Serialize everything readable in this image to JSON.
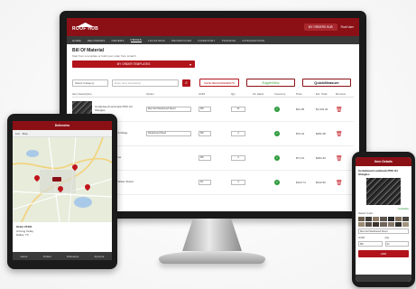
{
  "monitor": {
    "logo_text": "ROOF HUB",
    "branch_label": "MY ORDERS HUB",
    "user_label": "Roof User",
    "nav": [
      "HOME",
      "DELIVERIES",
      "ORDERS",
      "PRICES",
      "LOCATIONS",
      "PROMOTIONS",
      "INVENTORY",
      "TRAINING",
      "INTEGRATIONS"
    ],
    "active_nav": "PRICES",
    "page_title": "Bill Of Material",
    "page_subtitle": "Start from a template or build your order from scratch",
    "template_button": "MY ORDER TEMPLATES",
    "category_placeholder": "Select Category",
    "search_placeholder": "Enter Item description",
    "save_measurements": "SAVE MEASUREMENTS",
    "eagleview": "EagleView",
    "quickmeasure": "QuickMeasure",
    "columns": [
      "Item Description",
      "Option",
      "UOM",
      "Qty",
      "On Hand",
      "Inventory",
      "Price",
      "Ext. Total",
      "Remove"
    ],
    "rows": [
      {
        "desc": "Certainteed Landmark PRO H4 Shingles",
        "option": "Max Def Weathered Wood",
        "uom": "BD",
        "qty": "32",
        "price": "$31.95",
        "total": "$1,022.40"
      },
      {
        "desc": "Shadow Ridge Hip & Ridge",
        "option": "Weathered Wood",
        "uom": "BD",
        "qty": "4",
        "price": "$70.42",
        "total": "$281.68"
      },
      {
        "desc": "Roofers Select Starter",
        "option": "",
        "uom": "BD",
        "qty": "4",
        "price": "$71.10",
        "total": "$284.40"
      },
      {
        "desc": "WinterGuard Ice & Water Shield",
        "option": "",
        "uom": "RL",
        "qty": "4",
        "price": "$110.74",
        "total": "$442.96"
      }
    ]
  },
  "tablet": {
    "title": "Deliveries",
    "tools": [
      "List",
      "Map"
    ],
    "info_title": "Order #7401",
    "info_lines": [
      "Arriving Today",
      "Dallas, TX"
    ],
    "foot": [
      "Home",
      "Orders",
      "Deliveries",
      "Account"
    ]
  },
  "phone": {
    "title": "Item Details",
    "item_title": "Certainteed Landmark PRO H4 Shingles",
    "color_label": "Select Color",
    "selected_color": "Max Def Weathered Wood",
    "uom_label": "UOM",
    "uom_value": "BD",
    "qty_label": "Qty",
    "qty_value": "32",
    "instock": "Available",
    "add_button": "ADD",
    "swatch_colors": [
      "#6b5d4e",
      "#3e3a36",
      "#8a7a66",
      "#5b554e",
      "#2c2b2a",
      "#7c6d5a",
      "#4b4741",
      "#9a8b75",
      "#575049",
      "#3a342e",
      "#6f655a",
      "#86786a",
      "#2f2d2b",
      "#a29480"
    ]
  },
  "colors": {
    "brand_red": "#8b1016",
    "accent_red": "#b1141b",
    "success": "#2e9b3c"
  }
}
